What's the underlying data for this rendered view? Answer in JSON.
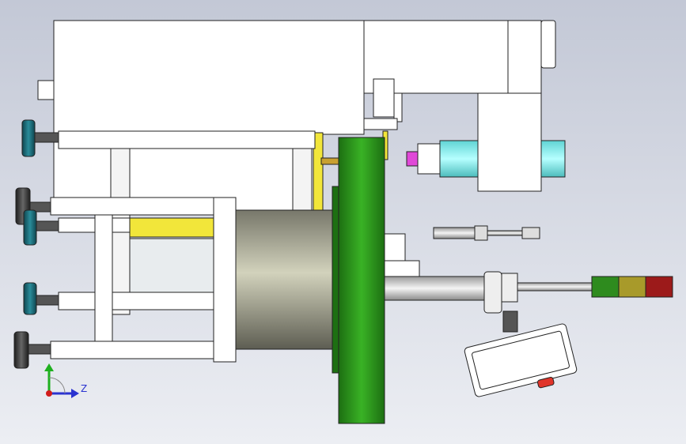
{
  "viewport": {
    "background_top": "#c3c8d6",
    "background_bottom": "#eceef3"
  },
  "triad": {
    "horizontal_axis_label": "Z",
    "vertical_axis_color": "#1fb01f",
    "horizontal_axis_color": "#2a33d0",
    "origin_color": "#d21c1c"
  },
  "colors": {
    "housing": "#ffffff",
    "outline": "#222222",
    "flange_green": "#2b9e1e",
    "flange_green_dark": "#1d6f12",
    "cylinder_light": "#c8c8b0",
    "cylinder_dark": "#77776a",
    "accent_yellow": "#f2e63a",
    "cyan_part": "#8ff0f0",
    "magenta_tip": "#e048d8",
    "foot_teal": "#1d6b78",
    "foot_dark": "#333333",
    "light_green": "#2e8b1e",
    "light_amber": "#a89a2a",
    "light_red": "#9c1a1a",
    "push_button_red": "#e0342a"
  }
}
